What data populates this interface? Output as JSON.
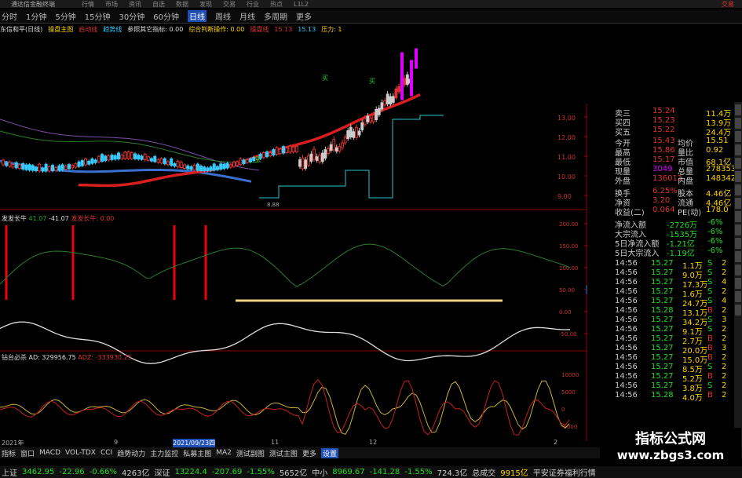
{
  "app": {
    "title": "通达信金融终端",
    "trade": "交易"
  },
  "menu": [
    {
      "label": "分时"
    },
    {
      "label": "1分钟"
    },
    {
      "label": "5分钟"
    },
    {
      "label": "15分钟"
    },
    {
      "label": "30分钟"
    },
    {
      "label": "60分钟"
    },
    {
      "label": "日线",
      "active": true
    },
    {
      "label": "周线"
    },
    {
      "label": "月线"
    },
    {
      "label": "多周期"
    },
    {
      "label": "更多"
    }
  ],
  "top_menu": [
    "行情",
    "市场",
    "资讯",
    "自选",
    "数据",
    "发现",
    "交易",
    "行业",
    "热点",
    "L1L2"
  ],
  "chart_header": {
    "stock": "东信和平(日线)",
    "items": [
      "操盘主图",
      "启动线",
      "趋势线",
      "参照其它指标: 0.00",
      "综合判断操作: 0.00",
      "操盘线",
      "15.13",
      "15.13",
      "压力: 1"
    ]
  },
  "price_axis": [
    "13.00",
    "12.00",
    "11.00",
    "10.00",
    "9.00"
  ],
  "price_labels": {
    "low": "8.88",
    "buy": [
      "买",
      "买",
      "买"
    ]
  },
  "ind1": {
    "name": "发发长牛",
    "v1": "41.07",
    "v2": "-41.07",
    "v3": "发发长牛: 0.00",
    "axis": [
      "200.00",
      "150.00",
      "100.00",
      "50.00",
      "0.00",
      "-50.00"
    ],
    "tag": "80.52"
  },
  "ind2": {
    "name": "钻台必杀",
    "ad": "AD: 329956.75",
    "adz": "ADZ: -333930.25",
    "axis": [
      "10000",
      "5000",
      "0",
      "-5000"
    ]
  },
  "dates": [
    "2021年",
    "9",
    "2021/09/23四",
    "11",
    "12",
    "2"
  ],
  "quote": {
    "ask3": [
      "卖三",
      "15.24",
      "11.4万"
    ],
    "bid1": [
      "买四",
      "15.23",
      "13.9万"
    ],
    "bid2": [
      "买五",
      "15.22",
      "24.4万"
    ],
    "rows": [
      [
        "今开",
        "15.43",
        "均价",
        "15.51"
      ],
      [
        "最高",
        "15.86",
        "量比",
        "0.92"
      ],
      [
        "最低",
        "15.17",
        "市值",
        "68.1亿"
      ],
      [
        "现量",
        "3049",
        "总量",
        "278353"
      ],
      [
        "外盘",
        "136011",
        "内盘",
        "148342"
      ],
      [
        "换手",
        "6.25%",
        "股本",
        "4.46亿"
      ],
      [
        "净资",
        "3.20",
        "流通",
        "4.46亿"
      ],
      [
        "收益(二)",
        "0.064",
        "PE(动)",
        "178.0"
      ]
    ],
    "flows": [
      [
        "净流入额",
        "-2726万",
        "-6%"
      ],
      [
        "大宗流入",
        "-1535万",
        "-6%"
      ],
      [
        "5日净流入额",
        "-1.21亿",
        "-6%"
      ],
      [
        "5日大宗流入",
        "-1.19亿",
        "-6%"
      ]
    ],
    "ticks": [
      [
        "14:56",
        "15.27",
        "1.1万",
        "S",
        "2"
      ],
      [
        "14:56",
        "15.27",
        "9.0万",
        "S",
        "2"
      ],
      [
        "14:56",
        "15.27",
        "17.3万",
        "S",
        "4"
      ],
      [
        "14:56",
        "15.27",
        "1.6万",
        "S",
        "2"
      ],
      [
        "14:56",
        "15.27",
        "24.7万",
        "S",
        "4"
      ],
      [
        "14:56",
        "15.28",
        "13.1万",
        "B",
        "2"
      ],
      [
        "14:56",
        "15.27",
        "34.2万",
        "S",
        "3"
      ],
      [
        "14:56",
        "15.27",
        "9.1万",
        "S",
        "2"
      ],
      [
        "14:56",
        "15.27",
        "2.7万",
        "B",
        "2"
      ],
      [
        "14:56",
        "15.27",
        "20.0万",
        "B",
        "3"
      ],
      [
        "14:56",
        "15.27",
        "15.0万",
        "B",
        "2"
      ],
      [
        "14:56",
        "15.27",
        "8.5万",
        "S",
        "2"
      ],
      [
        "14:56",
        "15.27",
        "5.2万",
        "B",
        "2"
      ],
      [
        "14:56",
        "15.27",
        "3.8万",
        "S",
        "2"
      ],
      [
        "14:56",
        "15.28",
        "4.0万",
        "B",
        "2"
      ]
    ]
  },
  "bottom_tabs": [
    "指标",
    "窗口",
    "MACD",
    "VOL-TDX",
    "CCI",
    "趋势动力",
    "主力监控",
    "私募主图",
    "MA2",
    "测试副图",
    "测试主图",
    "更多",
    "设置"
  ],
  "status": [
    [
      "上证",
      "3462.95",
      "-22.96",
      "-0.66%",
      "4263亿"
    ],
    [
      "深证",
      "13224.4",
      "-207.69",
      "-1.55%",
      "5652亿"
    ],
    [
      "中小",
      "8969.67",
      "-141.28",
      "-1.55%",
      "724.3亿"
    ]
  ],
  "status_extra": [
    "总成交",
    "9915亿",
    "平安证券福利行情"
  ],
  "watermark": {
    "cn": "指标公式网",
    "url": "www.zbgs3.com"
  }
}
